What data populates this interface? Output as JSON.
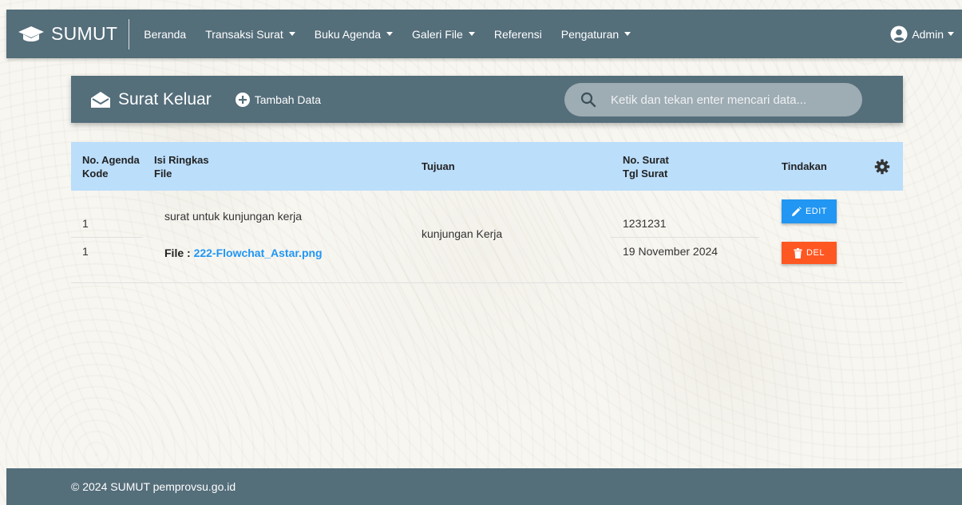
{
  "navbar": {
    "brand": "SUMUT",
    "items": [
      {
        "label": "Beranda",
        "dropdown": false
      },
      {
        "label": "Transaksi Surat",
        "dropdown": true
      },
      {
        "label": "Buku Agenda",
        "dropdown": true
      },
      {
        "label": "Galeri File",
        "dropdown": true
      },
      {
        "label": "Referensi",
        "dropdown": false
      },
      {
        "label": "Pengaturan",
        "dropdown": true
      }
    ],
    "user": "Admin"
  },
  "header": {
    "title": "Surat Keluar",
    "add_label": "Tambah Data",
    "search_placeholder": "Ketik dan tekan enter mencari data..."
  },
  "table": {
    "columns": {
      "col1_line1": "No. Agenda",
      "col1_line2": "Kode",
      "col2_line1": "Isi Ringkas",
      "col2_line2": "File",
      "col3": "Tujuan",
      "col4_line1": "No. Surat",
      "col4_line2": "Tgl Surat",
      "col5": "Tindakan"
    },
    "rows": [
      {
        "no_agenda": "1",
        "kode": "1",
        "isi_ringkas": "surat untuk kunjungan kerja",
        "file_label": "File :",
        "file_name": "222-Flowchat_Astar.png",
        "tujuan": "kunjungan Kerja",
        "no_surat": "1231231",
        "tgl_surat": "19 November 2024",
        "edit_label": "EDIT",
        "del_label": "DEL"
      }
    ]
  },
  "footer": {
    "text": "© 2024 SUMUT pemprovsu.go.id"
  },
  "colors": {
    "primary": "#546e7a",
    "table_header": "#bbdefb",
    "edit": "#2196f3",
    "delete": "#ff5722",
    "link": "#2196f3"
  }
}
